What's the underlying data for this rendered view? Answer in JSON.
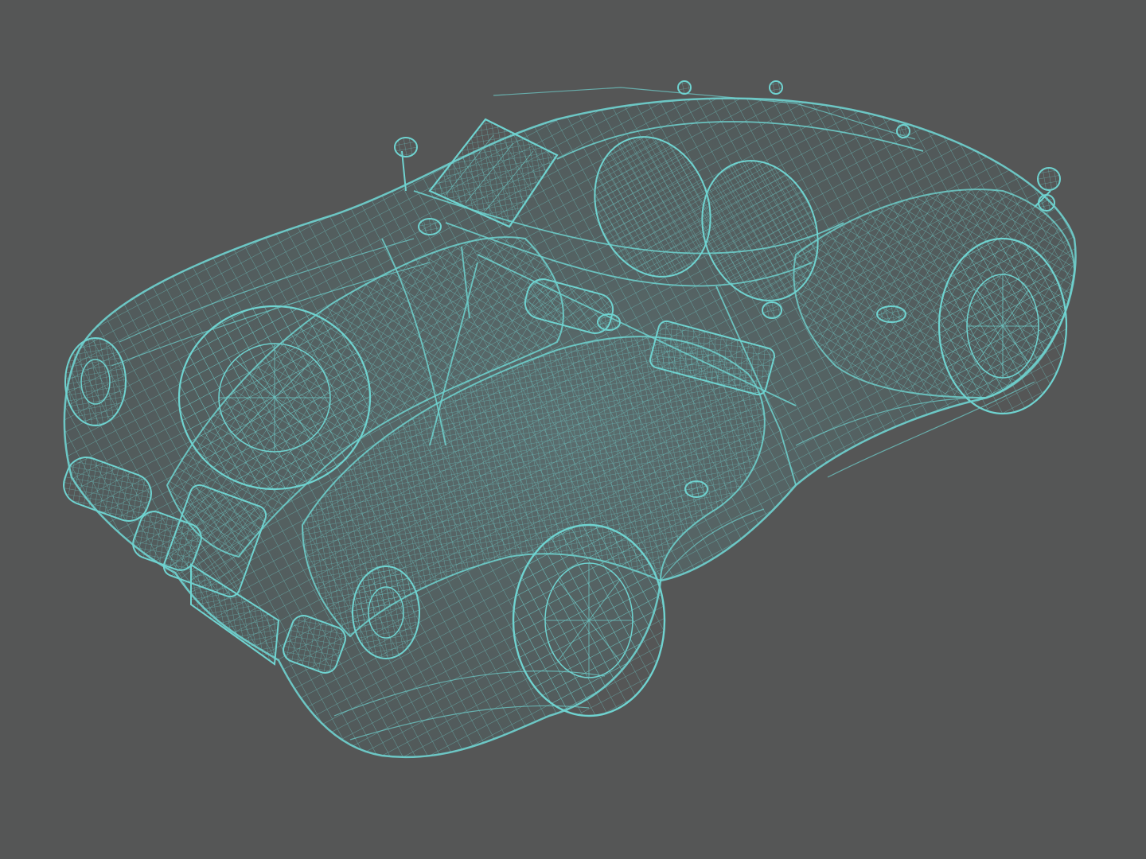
{
  "scene": {
    "subject": "wireframe-roadster",
    "render_style": "wireframe",
    "colors": {
      "background": "#555656",
      "wire": "#6fd3d0",
      "wire_dim": "#3f8f8e",
      "body_shade": "#4b6b6c"
    }
  }
}
